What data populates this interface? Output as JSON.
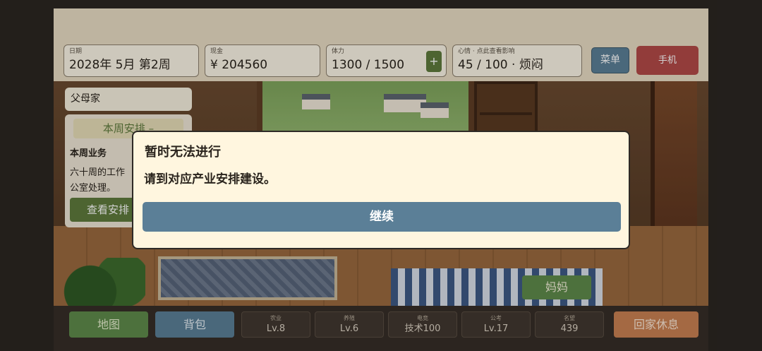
{
  "status": {
    "date": {
      "label": "日期",
      "value": "2028年 5月 第2周"
    },
    "cash": {
      "label": "现金",
      "value": "¥ 204560"
    },
    "stamina": {
      "label": "体力",
      "value": "1300 / 1500",
      "add_label": "+"
    },
    "mood": {
      "label": "心情 · 点此查看影响",
      "value": "45 / 100 · 烦闷"
    },
    "menu_label": "菜单",
    "phone_label": "手机"
  },
  "location": "父母家",
  "weekly_panel": {
    "title": "本周安排 –",
    "subtitle": "本周业务",
    "body": "六十周的工作 公室处理。",
    "button_label": "查看安排"
  },
  "npc_label": "妈妈",
  "bottom": {
    "map_label": "地图",
    "bag_label": "背包",
    "stats": [
      {
        "title": "农业",
        "value": "Lv.8"
      },
      {
        "title": "养殖",
        "value": "Lv.6"
      },
      {
        "title": "电竞",
        "value": "技术100"
      },
      {
        "title": "公考",
        "value": "Lv.17"
      },
      {
        "title": "名望",
        "value": "439"
      }
    ],
    "home_label": "回家休息"
  },
  "dialog": {
    "title": "暂时无法进行",
    "message": "请到对应产业安排建设。",
    "button_label": "继续"
  },
  "colors": {
    "accent_blue": "#5b7f97",
    "accent_green": "#5e7b3c",
    "accent_red": "#b24a47",
    "accent_orange": "#c98152",
    "dialog_bg": "#fff6df"
  }
}
